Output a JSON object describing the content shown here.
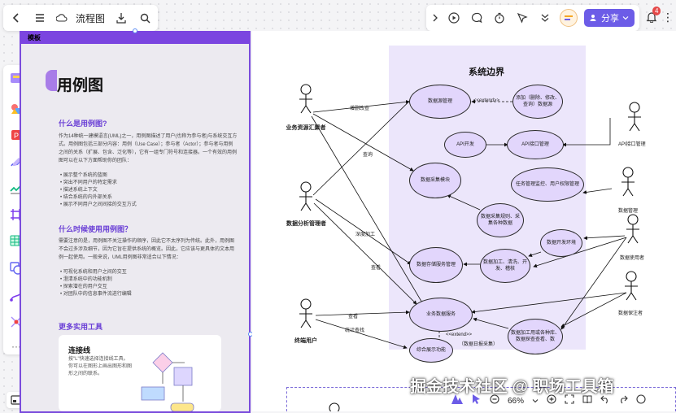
{
  "toolbar": {
    "title": "流程图",
    "share_label": "分享",
    "notification_count": "4"
  },
  "panel": {
    "header": "模板",
    "title": "用例图",
    "section1_heading": "什么是用例图?",
    "section1_text": "作为14种统一建模语言(UML)之一，用例图描述了用户(也称为参与者)与系统交互方式。用例图包括三部分内容：用例（Use Case）；参与者（Actor）；参与者与用例之间的关系（扩展、包含、泛化等），它有一组专门符号和连接器。一个有效的用例图可以在以下方面帮助你的团队：",
    "section1_bullets": [
      "展示整个系统的蓝图",
      "突出不同用户的特定需求",
      "描述系统上下文",
      "结合系统的内外部关系",
      "展示不同用户之间间接的交互方式"
    ],
    "section2_heading": "什么时候使用用例图？",
    "section2_text": "需要注意的是，用例图不关注操作的顺序，因此它不太序列为传统。此外，用例图不会过多涉及细节，因为它旨在提供系统的概览。因此，它应该与更具体的文本用例一起使用。一般来说，UML用例图非常适合以下情况：",
    "section2_bullets": [
      "可视化系统和用户之间的交互",
      "澄清系统中的功能机制",
      "探索潜在的用户交互",
      "对团队中的信息事件流进行编辑"
    ],
    "section3_heading": "更多实用工具",
    "tip_title": "连接线",
    "tip_text": "按\"L\"快速选择连接线工具。你可以在图形上画出图形和图形之间的联系。"
  },
  "diagram": {
    "boundary_title": "系统边界",
    "use_cases": {
      "data_mgmt": "数据源管理",
      "add_edit": "添加（删除、修改、查询）数据源",
      "api_dev": "API开发",
      "api_interface": "API接口管理",
      "task_monitor": "任务管理监控、用户权限管理",
      "data_collect": "数据采集模块",
      "collect_detail": "数据采集规则、采集各种数据",
      "data_service": "数据存储服务管理",
      "process_detail": "数据加工、清洗、开发、稽核",
      "dev_env": "数据开发环境",
      "biz_service": "业务数据服务",
      "analysis": "数据加工用或各种库、数据探查查看、数",
      "multi_display": "综合展示功能"
    },
    "actors": {
      "biz_admin": "业务资源汇聚者",
      "analyst": "数据分析管理者",
      "end_user": "终端用户",
      "api_user": "API接口管理",
      "data_operator": "数据管理",
      "data_user": "数据使用者",
      "data_maintainer": "数据保注者"
    },
    "edge_labels": {
      "add_data": "增删改查",
      "query": "查询",
      "extend1": "<<extend>>",
      "deep_process": "深度加工",
      "view": "查看",
      "view2": "查看",
      "stats_query": "统计查找",
      "extend2": "<<extend>>",
      "extend2_note": "（数据日报采集）"
    }
  },
  "bottombar": {
    "zoom": "66%"
  },
  "watermark": "掘金技术社区 @ 职场工具箱"
}
